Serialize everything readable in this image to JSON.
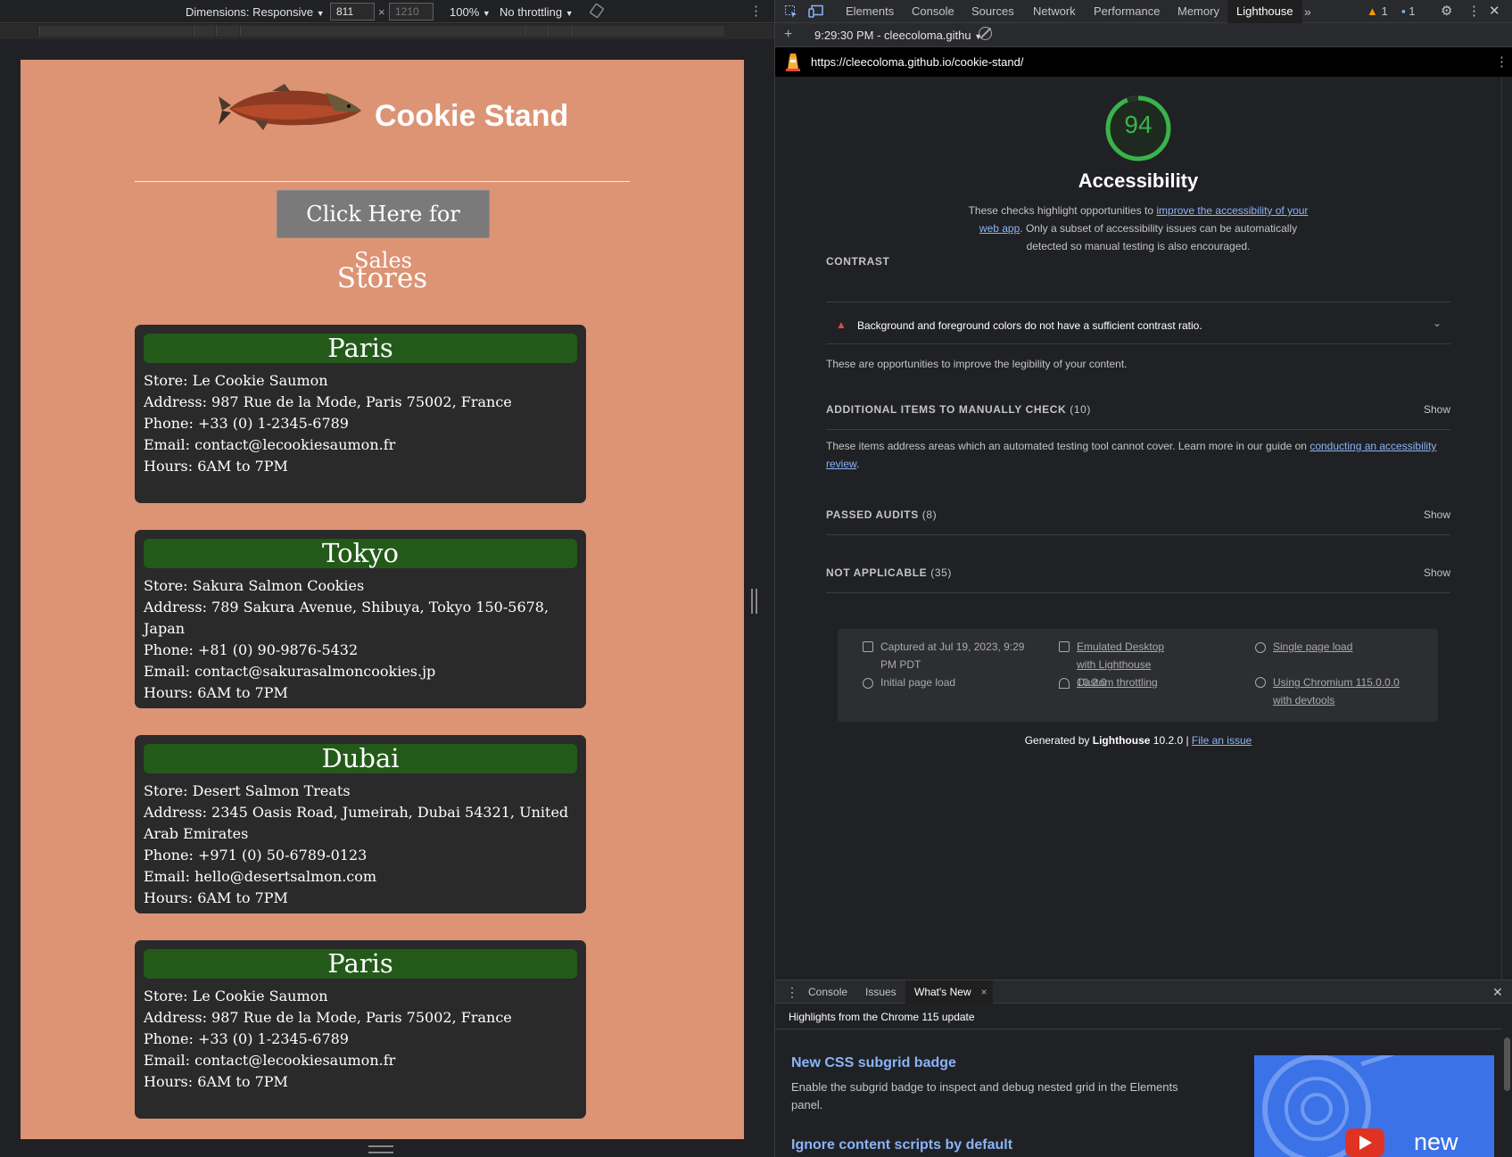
{
  "devtoolbar": {
    "dimensions_label": "Dimensions: Responsive",
    "width_value": "811",
    "times": "×",
    "height_placeholder": "1210",
    "zoom": "100%",
    "throttling": "No throttling"
  },
  "site": {
    "title": "Cookie Stand",
    "sales_button": "Click Here for Sales",
    "stores_heading": "Stores",
    "stores": [
      {
        "city": "Paris",
        "store": "Store: Le Cookie Saumon",
        "address": "Address: 987 Rue de la Mode, Paris 75002, France",
        "phone": "Phone: +33 (0) 1-2345-6789",
        "email": "Email: contact@lecookiesaumon.fr",
        "hours": "Hours: 6AM to 7PM"
      },
      {
        "city": "Tokyo",
        "store": "Store: Sakura Salmon Cookies",
        "address": "Address: 789 Sakura Avenue, Shibuya, Tokyo 150-5678, Japan",
        "phone": "Phone: +81 (0) 90-9876-5432",
        "email": "Email: contact@sakurasalmoncookies.jp",
        "hours": "Hours: 6AM to 7PM"
      },
      {
        "city": "Dubai",
        "store": "Store: Desert Salmon Treats",
        "address": "Address: 2345 Oasis Road, Jumeirah, Dubai 54321, United Arab Emirates",
        "phone": "Phone: +971 (0) 50-6789-0123",
        "email": "Email: hello@desertsalmon.com",
        "hours": "Hours: 6AM to 7PM"
      },
      {
        "city": "Paris",
        "store": "Store: Le Cookie Saumon",
        "address": "Address: 987 Rue de la Mode, Paris 75002, France",
        "phone": "Phone: +33 (0) 1-2345-6789",
        "email": "Email: contact@lecookiesaumon.fr",
        "hours": "Hours: 6AM to 7PM"
      }
    ]
  },
  "devtools": {
    "tabs": [
      "Elements",
      "Console",
      "Sources",
      "Network",
      "Performance",
      "Memory",
      "Lighthouse"
    ],
    "active_tab": "Lighthouse",
    "warn_count": "1",
    "info_count": "1",
    "report_select": "9:29:30 PM - cleecoloma.githu",
    "url": "https://cleecoloma.github.io/cookie-stand/",
    "score": "94",
    "category": "Accessibility",
    "desc_pre": "These checks highlight opportunities to ",
    "desc_link": "improve the accessibility of your web app",
    "desc_post": ". Only a subset of accessibility issues can be automatically detected so manual testing is also encouraged.",
    "contrast_heading": "CONTRAST",
    "contrast_audit": "Background and foreground colors do not have a sufficient contrast ratio.",
    "contrast_note": "These are opportunities to improve the legibility of your content.",
    "manual_heading": "ADDITIONAL ITEMS TO MANUALLY CHECK",
    "manual_count": "(10)",
    "manual_note_pre": "These items address areas which an automated testing tool cannot cover. Learn more in our guide on ",
    "manual_note_link": "conducting an accessibility review",
    "manual_note_post": ".",
    "passed_heading": "PASSED AUDITS",
    "passed_count": "(8)",
    "na_heading": "NOT APPLICABLE",
    "na_count": "(35)",
    "show": "Show",
    "env": {
      "captured": "Captured at Jul 19, 2023, 9:29 PM PDT",
      "initial_load": "Initial page load",
      "emulated": "Emulated Desktop with Lighthouse 10.2.0",
      "throttling": "Custom throttling",
      "single_load": "Single page load",
      "chromium": "Using Chromium 115.0.0.0 with devtools"
    },
    "generated_pre": "Generated by ",
    "generated_brand": "Lighthouse",
    "generated_ver": " 10.2.0 | ",
    "file_issue": "File an issue"
  },
  "drawer": {
    "tabs": [
      "Console",
      "Issues",
      "What's New"
    ],
    "highlights": "Highlights from the Chrome 115 update",
    "news1_title": "New CSS subgrid badge",
    "news1_body": "Enable the subgrid badge to inspect and debug nested grid in the Elements panel.",
    "news2_title": "Ignore content scripts by default",
    "thumb_text": "new"
  },
  "colors": {
    "page_bg": "#dc9475",
    "card_bg": "#2a2a2a",
    "city_bar": "#235a1a",
    "score_green": "#39b44a",
    "link": "#8ab4f8",
    "warn": "#e8453c"
  }
}
